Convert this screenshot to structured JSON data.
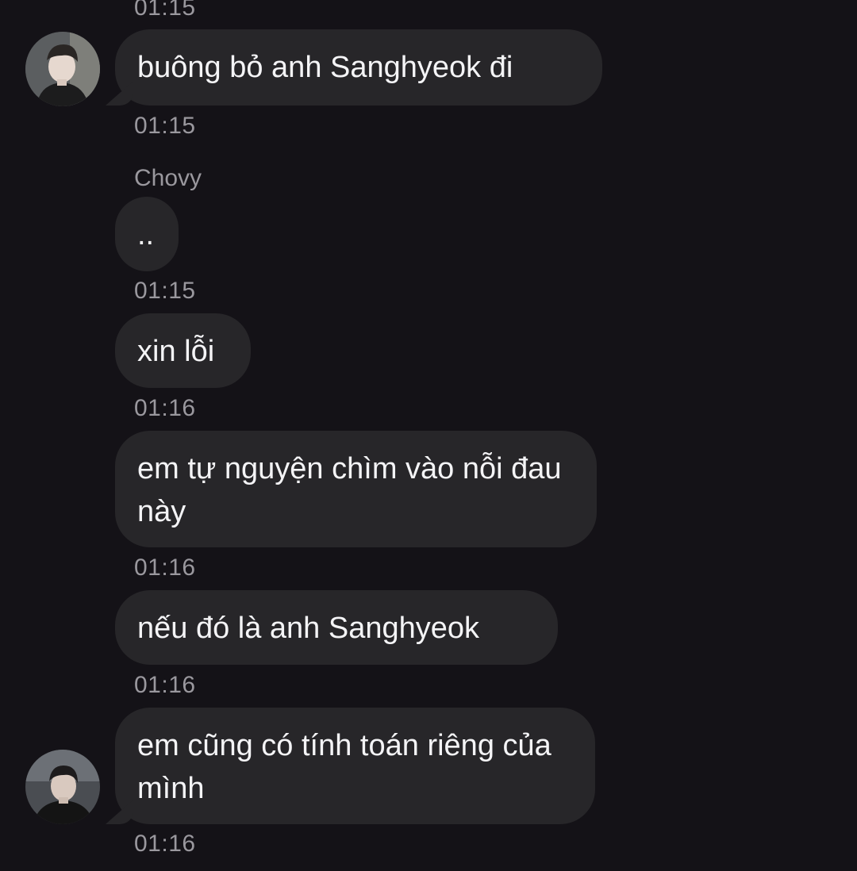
{
  "messages": [
    {
      "time_top": "01:15"
    },
    {
      "text": "buông bỏ anh Sanghyeok đi",
      "time": "01:15"
    },
    {
      "sender": "Chovy",
      "text": "..",
      "time": "01:15"
    },
    {
      "text": "xin lỗi",
      "time": "01:16"
    },
    {
      "text": "em tự nguyện chìm vào nỗi đau này",
      "time": "01:16"
    },
    {
      "text": "nếu đó là anh Sanghyeok",
      "time": "01:16"
    },
    {
      "text": "em cũng có tính toán riêng của mình",
      "time": "01:16"
    }
  ],
  "colors": {
    "background": "#141217",
    "bubble": "#272629",
    "text": "#f4f4f6",
    "meta": "#9a989e"
  },
  "icons": {
    "avatar_top": "user-avatar-icon",
    "avatar_bottom": "user-avatar-icon"
  }
}
